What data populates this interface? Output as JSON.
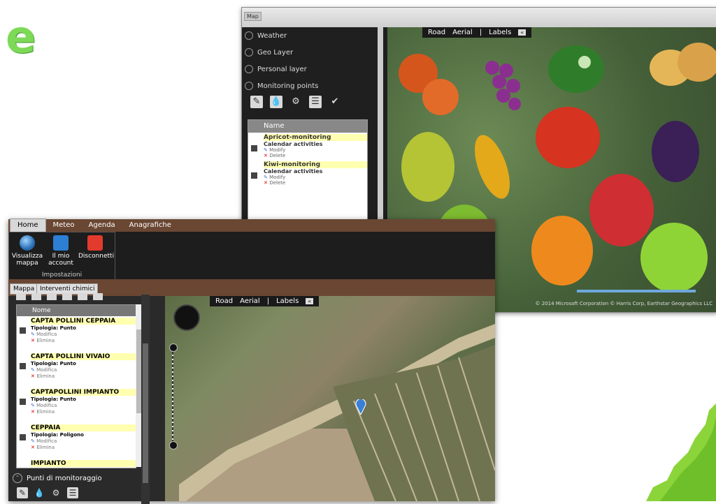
{
  "back_window": {
    "title": "Map",
    "layers": [
      "Weather",
      "Geo Layer",
      "Personal layer",
      "Monitoring points"
    ],
    "list_header": "Name",
    "items": [
      {
        "name": "Apricot-monitoring",
        "type": "Calendar activities",
        "modify": "Modify",
        "delete": "Delete"
      },
      {
        "name": "Kiwi-monitoring",
        "type": "Calendar activities",
        "modify": "Modify",
        "delete": "Delete"
      }
    ],
    "map_toolbar": {
      "road": "Road",
      "aerial": "Aerial",
      "labels": "Labels",
      "collapse": "«"
    },
    "copyright": "© 2014 Microsoft Corporation  © Harris Corp, Earthstar Geographics LLC"
  },
  "front_window": {
    "menu_tabs": [
      "Home",
      "Meteo",
      "Agenda",
      "Anagrafiche"
    ],
    "active_menu_tab": "Home",
    "ribbon": {
      "buttons": [
        {
          "label": "Visualizza mappa",
          "icon": "globe-icon"
        },
        {
          "label": "Il mio account",
          "icon": "user-icon"
        },
        {
          "label": "Disconnetti",
          "icon": "power-icon"
        }
      ],
      "group_label": "Impostazioni"
    },
    "sub_tabs": [
      "Mappa",
      "Interventi chimici"
    ],
    "list_header": "Nome",
    "items": [
      {
        "name": "CAPTA POLLINI CEPPAIA",
        "type": "Tipologia: Punto",
        "modify": "Modifica",
        "delete": "Elimina"
      },
      {
        "name": "CAPTA POLLINI VIVAIO",
        "type": "Tipologia: Punto",
        "modify": "Modifica",
        "delete": "Elimina"
      },
      {
        "name": "CAPTAPOLLINI IMPIANTO",
        "type": "Tipologia: Punto",
        "modify": "Modifica",
        "delete": "Elimina"
      },
      {
        "name": "CEPPAIA",
        "type": "Tipologia: Poligono",
        "modify": "Modifica",
        "delete": "Elimina"
      },
      {
        "name": "IMPIANTO",
        "type": "",
        "modify": "",
        "delete": ""
      }
    ],
    "punti_label": "Punti di monitoraggio",
    "map_toolbar": {
      "road": "Road",
      "aerial": "Aerial",
      "labels": "Labels",
      "collapse": "«"
    }
  },
  "logo_letter": "e",
  "colors": {
    "brown": "#6a4733",
    "accent_green": "#7ed957",
    "highlight": "#ffffb0"
  }
}
